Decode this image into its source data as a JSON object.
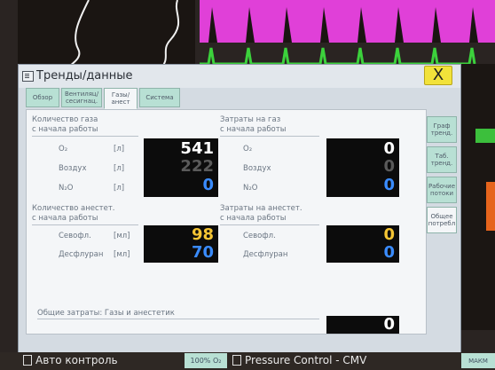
{
  "colors": {
    "value_white": "#ffffff",
    "value_gray": "#5a5a5a",
    "value_blue": "#3a8cff",
    "value_yellow": "#f5c534",
    "tab_green": "#b8e0d4",
    "close_yellow": "#f2e23a"
  },
  "dialog": {
    "title": "Тренды/данные",
    "close_label": "X",
    "tabs": [
      "Обзор",
      "Вентиляц/ сесигнац.",
      "Газы/ анест",
      "Система"
    ],
    "active_tab": 2,
    "side_buttons": [
      "Граф тренд.",
      "Таб. тренд.",
      "Рабочие потоки",
      "Общее потребл"
    ],
    "active_side": 3
  },
  "gas_since_start": {
    "title_line1": "Количество газа",
    "title_line2": "с начала работы",
    "rows": [
      {
        "label": "O₂",
        "unit": "[л]",
        "value": "541",
        "color": "#ffffff"
      },
      {
        "label": "Воздух",
        "unit": "[л]",
        "value": "222",
        "color": "#5a5a5a"
      },
      {
        "label": "N₂O",
        "unit": "[л]",
        "value": "0",
        "color": "#3a8cff"
      }
    ]
  },
  "gas_cost": {
    "title_line1": "Затраты на газ",
    "title_line2": "с начала работы",
    "rows": [
      {
        "label": "O₂",
        "value": "0",
        "color": "#ffffff"
      },
      {
        "label": "Воздух",
        "value": "0",
        "color": "#5a5a5a"
      },
      {
        "label": "N₂O",
        "value": "0",
        "color": "#3a8cff"
      }
    ]
  },
  "anesthetic_since_start": {
    "title_line1": "Количество анестет.",
    "title_line2": "с начала работы",
    "rows": [
      {
        "label": "Севофл.",
        "unit": "[мл]",
        "value": "98",
        "color": "#f5c534"
      },
      {
        "label": "Десфлуран",
        "unit": "[мл]",
        "value": "70",
        "color": "#3a8cff"
      }
    ]
  },
  "anesthetic_cost": {
    "title_line1": "Затраты на анестет.",
    "title_line2": "с начала работы",
    "rows": [
      {
        "label": "Севофл.",
        "value": "0",
        "color": "#f5c534"
      },
      {
        "label": "Десфлуран",
        "value": "0",
        "color": "#3a8cff"
      }
    ]
  },
  "total": {
    "label": "Общие затраты: Газы и анестетик",
    "value": "0"
  },
  "statusbar": {
    "left_label": "Авто контроль",
    "o2_label": "100% O₂",
    "mode": "Pressure Control - CMV",
    "right_label": "МАКМ"
  }
}
